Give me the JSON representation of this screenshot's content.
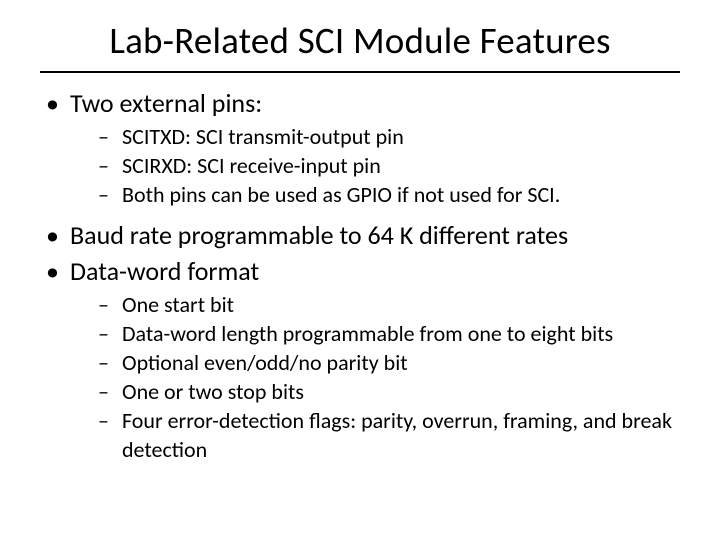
{
  "title": "Lab-Related SCI Module Features",
  "bullets": {
    "b0": {
      "text": "Two external pins:",
      "sub": [
        " SCITXD: SCI transmit-output pin",
        " SCIRXD: SCI receive-input pin",
        "Both pins can be used as GPIO if not used for SCI."
      ]
    },
    "b1": {
      "text": "Baud rate programmable to 64 K different rates"
    },
    "b2": {
      "text": "Data-word format",
      "sub": [
        " One start bit",
        " Data-word length programmable from one to eight bits",
        " Optional even/odd/no parity bit",
        "One or two stop bits",
        "Four error-detection flags: parity, overrun, framing, and break detection"
      ]
    }
  }
}
